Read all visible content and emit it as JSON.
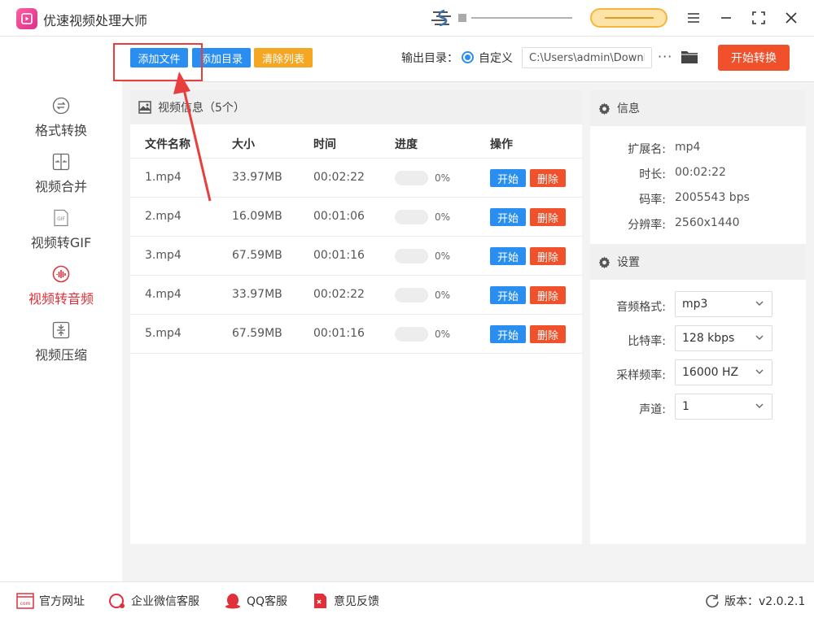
{
  "app": {
    "title": "优速视频处理大师",
    "version": "版本：v2.0.2.1"
  },
  "toolbar": {
    "add_file": "添加文件",
    "add_dir": "添加目录",
    "clear_list": "清除列表",
    "output_label": "输出目录：",
    "custom_label": "自定义",
    "path_value": "C:\\Users\\admin\\Downlc",
    "more": "···",
    "start_convert": "开始转换"
  },
  "sidebar": {
    "items": [
      {
        "label": "格式转换",
        "icon": "format-convert-icon"
      },
      {
        "label": "视频合并",
        "icon": "merge-icon"
      },
      {
        "label": "视频转GIF",
        "icon": "gif-icon"
      },
      {
        "label": "视频转音频",
        "icon": "audio-icon",
        "active": true
      },
      {
        "label": "视频压缩",
        "icon": "compress-icon"
      }
    ]
  },
  "file_panel": {
    "title": "视频信息（5个）",
    "columns": [
      "文件名称",
      "大小",
      "时间",
      "进度",
      "操作"
    ],
    "rows": [
      {
        "name": "1.mp4",
        "size": "33.97MB",
        "time": "00:02:22",
        "progress": "0%"
      },
      {
        "name": "2.mp4",
        "size": "16.09MB",
        "time": "00:01:06",
        "progress": "0%"
      },
      {
        "name": "3.mp4",
        "size": "67.59MB",
        "time": "00:01:16",
        "progress": "0%"
      },
      {
        "name": "4.mp4",
        "size": "33.97MB",
        "time": "00:02:22",
        "progress": "0%"
      },
      {
        "name": "5.mp4",
        "size": "67.59MB",
        "time": "00:01:16",
        "progress": "0%"
      }
    ],
    "start_label": "开始",
    "delete_label": "删除"
  },
  "info_panel": {
    "title": "信息",
    "fields": [
      {
        "label": "扩展名:",
        "value": "mp4"
      },
      {
        "label": "时长:",
        "value": "00:02:22"
      },
      {
        "label": "码率:",
        "value": "2005543 bps"
      },
      {
        "label": "分辨率:",
        "value": "2560x1440"
      }
    ]
  },
  "settings_panel": {
    "title": "设置",
    "fields": [
      {
        "label": "音频格式:",
        "value": "mp3"
      },
      {
        "label": "比特率:",
        "value": "128 kbps"
      },
      {
        "label": "采样频率:",
        "value": "16000 HZ"
      },
      {
        "label": "声道:",
        "value": "1"
      }
    ]
  },
  "footer": {
    "website": "官方网址",
    "wecom": "企业微信客服",
    "qq": "QQ客服",
    "feedback": "意见反馈"
  },
  "colors": {
    "primary": "#2a8ef0",
    "danger": "#f0502a",
    "warning": "#f5a623",
    "active": "#e0303a"
  }
}
